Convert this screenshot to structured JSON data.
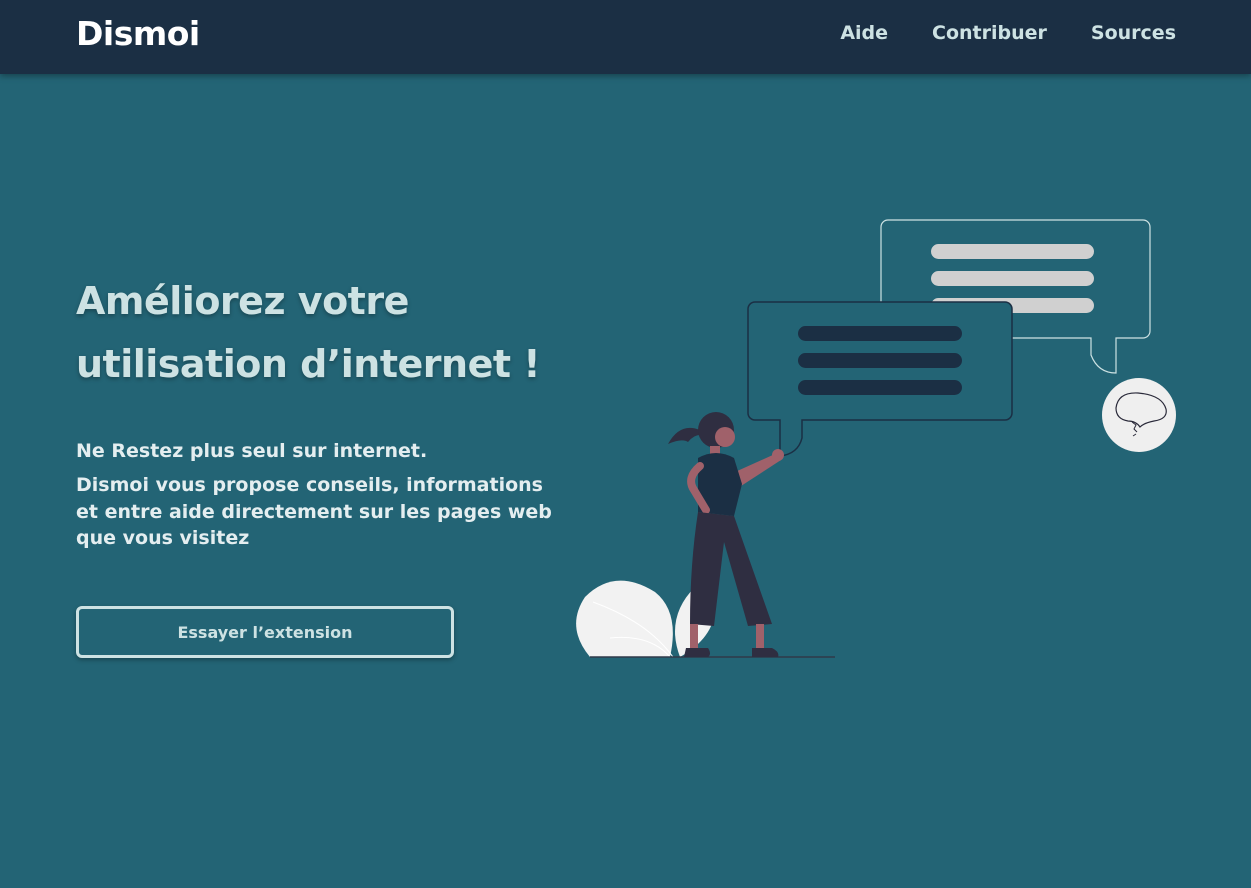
{
  "header": {
    "logo": "Dismoi",
    "nav": [
      {
        "label": "Aide"
      },
      {
        "label": "Contribuer"
      },
      {
        "label": "Sources"
      }
    ]
  },
  "hero": {
    "title_line1": "Améliorez votre",
    "title_line2": "utilisation d’internet !",
    "lead": "Ne Restez plus seul sur internet.",
    "description": "Dismoi vous propose conseils, informations et entre aide directement sur les pages web que vous visitez",
    "cta_label": "Essayer l’extension"
  },
  "colors": {
    "background": "#236475",
    "topbar": "#1b2f44",
    "text_light": "#cde2e3",
    "accent_dark": "#1b2f44"
  },
  "icons": {
    "illustration": "woman-with-chat-bubbles-illustration"
  }
}
